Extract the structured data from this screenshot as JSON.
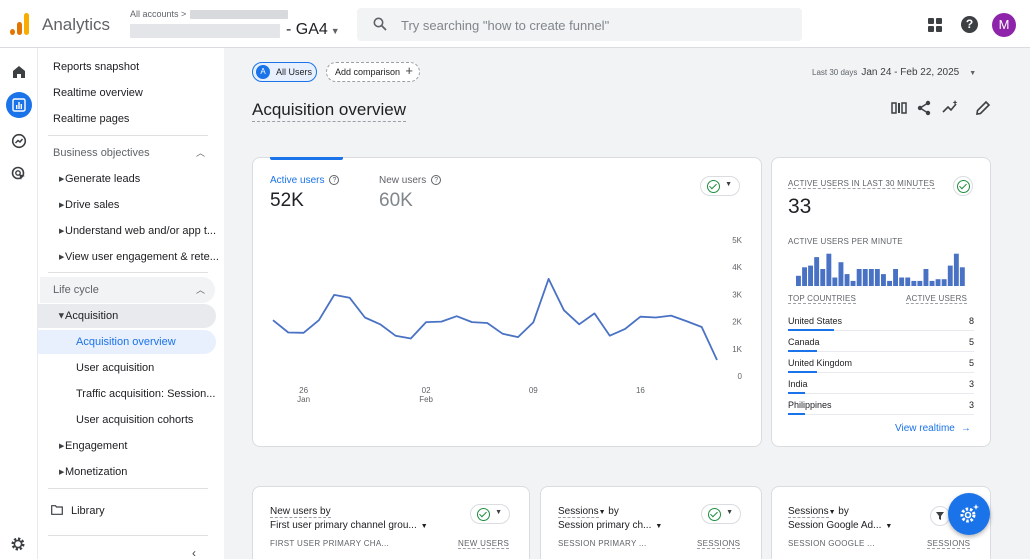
{
  "header": {
    "app_name": "Analytics",
    "account_crumb": "All accounts >",
    "property": "- GA4",
    "search_placeholder": "Try searching \"how to create funnel\"",
    "avatar_letter": "M"
  },
  "nav": {
    "top_items": [
      "Reports snapshot",
      "Realtime overview",
      "Realtime pages"
    ],
    "business_objectives": {
      "label": "Business objectives",
      "items": [
        "Generate leads",
        "Drive sales",
        "Understand web and/or app t...",
        "View user engagement & rete..."
      ]
    },
    "life_cycle": {
      "label": "Life cycle",
      "acquisition": {
        "label": "Acquisition",
        "items": [
          "Acquisition overview",
          "User acquisition",
          "Traffic acquisition: Session...",
          "User acquisition cohorts"
        ]
      },
      "other": [
        "Engagement",
        "Monetization"
      ]
    },
    "library": "Library"
  },
  "toolbar": {
    "chip_all_users_letter": "A",
    "chip_all_users": "All Users",
    "add_comparison": "Add comparison",
    "date_label": "Last 30 days",
    "date_range": "Jan 24 - Feb 22, 2025",
    "page_title": "Acquisition overview"
  },
  "main_card": {
    "metric1_label": "Active users",
    "metric1_value": "52K",
    "metric2_label": "New users",
    "metric2_value": "60K"
  },
  "chart_data": {
    "type": "line",
    "title": "",
    "xlabel": "",
    "ylabel": "",
    "series": [
      {
        "name": "Active users",
        "values": [
          2050,
          1600,
          1590,
          2050,
          2980,
          2880,
          2150,
          1900,
          1480,
          1380,
          1980,
          2000,
          2200,
          1980,
          1950,
          1550,
          1430,
          1970,
          3570,
          2420,
          1900,
          2300,
          1480,
          1730,
          2180,
          2150,
          2220,
          2020,
          1800,
          590
        ]
      }
    ],
    "x_tick_labels": [
      {
        "index": 2,
        "day": "26",
        "month": "Jan"
      },
      {
        "index": 10,
        "day": "02",
        "month": "Feb"
      },
      {
        "index": 17,
        "day": "09",
        "month": ""
      },
      {
        "index": 24,
        "day": "16",
        "month": ""
      }
    ],
    "y_ticks": [
      "0",
      "1K",
      "2K",
      "3K",
      "4K",
      "5K"
    ],
    "ylim": [
      0,
      5000
    ],
    "color": "#4a72c4",
    "grid": false
  },
  "realtime": {
    "label": "ACTIVE USERS IN LAST 30 MINUTES",
    "value": "33",
    "per_minute_label": "ACTIVE USERS PER MINUTE",
    "per_minute_values": [
      0.3,
      0.55,
      0.6,
      0.85,
      0.5,
      0.95,
      0.25,
      0.7,
      0.35,
      0.15,
      0.5,
      0.5,
      0.5,
      0.5,
      0.35,
      0.15,
      0.5,
      0.25,
      0.25,
      0.15,
      0.15,
      0.5,
      0.15,
      0.2,
      0.2,
      0.6,
      0.95,
      0.55
    ],
    "col_country": "TOP COUNTRIES",
    "col_users": "ACTIVE USERS",
    "countries": [
      {
        "name": "United States",
        "value": "8",
        "frac": 1.0
      },
      {
        "name": "Canada",
        "value": "5",
        "frac": 0.62
      },
      {
        "name": "United Kingdom",
        "value": "5",
        "frac": 0.62
      },
      {
        "name": "India",
        "value": "3",
        "frac": 0.38
      },
      {
        "name": "Philippines",
        "value": "3",
        "frac": 0.38
      }
    ],
    "view_realtime": "View realtime"
  },
  "bottom_cards": [
    {
      "title1": "New users by",
      "title2": "First user primary channel grou...",
      "col1": "FIRST USER PRIMARY CHA...",
      "col2": "NEW USERS"
    },
    {
      "title1": "Sessions",
      "title1b": "by",
      "title2": "Session primary ch...",
      "col1": "SESSION PRIMARY ...",
      "col2": "SESSIONS"
    },
    {
      "title1": "Sessions",
      "title1b": "by",
      "title2": "Session Google Ad...",
      "col1": "SESSION GOOGLE ...",
      "col2": "SESSIONS"
    }
  ],
  "colors": {
    "accent": "#1a73e8",
    "line": "#4a72c4",
    "success": "#1e8e3e"
  }
}
